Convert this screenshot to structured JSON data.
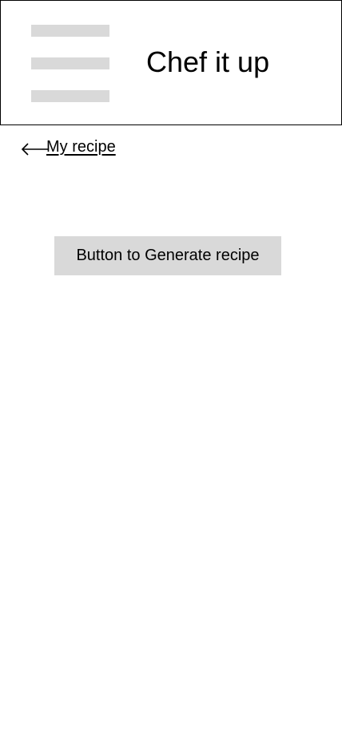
{
  "header": {
    "menu_icon": "hamburger-menu-icon",
    "title": "Chef it up"
  },
  "nav": {
    "back_icon": "arrow-left-icon",
    "back_label": "My recipe"
  },
  "main": {
    "generate_button_label": "Button to Generate recipe"
  },
  "colors": {
    "placeholder_gray": "#d9d9d9",
    "text": "#000000",
    "background": "#ffffff",
    "border": "#000000"
  }
}
